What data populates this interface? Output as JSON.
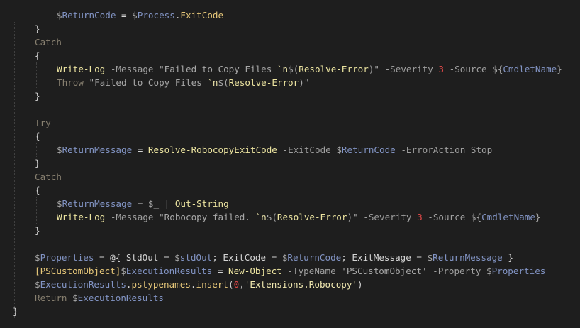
{
  "editor": {
    "colors": {
      "background": "#1e1e1e",
      "keyword": "#888070",
      "variable": "#8294c4",
      "function": "#ece4a0",
      "property": "#e6c779",
      "string": "#a8a8a8",
      "number": "#e04848"
    },
    "lines": [
      {
        "indent": 2,
        "tokens": [
          {
            "t": "$",
            "c": "var"
          },
          {
            "t": "ReturnCode",
            "c": "varname"
          },
          {
            "t": " = ",
            "c": "plain"
          },
          {
            "t": "$",
            "c": "var"
          },
          {
            "t": "Process",
            "c": "varname"
          },
          {
            "t": ".",
            "c": "plain"
          },
          {
            "t": "ExitCode",
            "c": "prop"
          }
        ]
      },
      {
        "indent": 1,
        "tokens": [
          {
            "t": "}",
            "c": "plain"
          }
        ]
      },
      {
        "indent": 1,
        "tokens": [
          {
            "t": "Catch",
            "c": "kw"
          }
        ]
      },
      {
        "indent": 1,
        "tokens": [
          {
            "t": "{",
            "c": "plain"
          }
        ]
      },
      {
        "indent": 2,
        "tokens": [
          {
            "t": "Write-Log",
            "c": "fn"
          },
          {
            "t": " -Message ",
            "c": "param"
          },
          {
            "t": "\"Failed to Copy Files ",
            "c": "str"
          },
          {
            "t": "`n",
            "c": "esc"
          },
          {
            "t": "$(",
            "c": "str"
          },
          {
            "t": "Resolve-Error",
            "c": "fn"
          },
          {
            "t": ")\"",
            "c": "str"
          },
          {
            "t": " -Severity ",
            "c": "param"
          },
          {
            "t": "3",
            "c": "num"
          },
          {
            "t": " -Source ",
            "c": "param"
          },
          {
            "t": "${",
            "c": "var"
          },
          {
            "t": "CmdletName",
            "c": "varname"
          },
          {
            "t": "}",
            "c": "var"
          }
        ]
      },
      {
        "indent": 2,
        "tokens": [
          {
            "t": "Throw",
            "c": "kw"
          },
          {
            "t": " \"Failed to Copy Files ",
            "c": "str"
          },
          {
            "t": "`n",
            "c": "esc"
          },
          {
            "t": "$(",
            "c": "str"
          },
          {
            "t": "Resolve-Error",
            "c": "fn"
          },
          {
            "t": ")\"",
            "c": "str"
          }
        ]
      },
      {
        "indent": 1,
        "tokens": [
          {
            "t": "}",
            "c": "plain"
          }
        ]
      },
      {
        "indent": 0,
        "tokens": []
      },
      {
        "indent": 1,
        "tokens": [
          {
            "t": "Try",
            "c": "kw"
          }
        ]
      },
      {
        "indent": 1,
        "tokens": [
          {
            "t": "{",
            "c": "plain"
          }
        ]
      },
      {
        "indent": 2,
        "tokens": [
          {
            "t": "$",
            "c": "var"
          },
          {
            "t": "ReturnMessage",
            "c": "varname"
          },
          {
            "t": " = ",
            "c": "plain"
          },
          {
            "t": "Resolve-RobocopyExitCode",
            "c": "fn"
          },
          {
            "t": " -ExitCode ",
            "c": "param"
          },
          {
            "t": "$",
            "c": "var"
          },
          {
            "t": "ReturnCode",
            "c": "varname"
          },
          {
            "t": " -ErrorAction Stop",
            "c": "param"
          }
        ]
      },
      {
        "indent": 1,
        "tokens": [
          {
            "t": "}",
            "c": "plain"
          }
        ]
      },
      {
        "indent": 1,
        "tokens": [
          {
            "t": "Catch",
            "c": "kw"
          }
        ]
      },
      {
        "indent": 1,
        "tokens": [
          {
            "t": "{",
            "c": "plain"
          }
        ]
      },
      {
        "indent": 2,
        "tokens": [
          {
            "t": "$",
            "c": "var"
          },
          {
            "t": "ReturnMessage",
            "c": "varname"
          },
          {
            "t": " = ",
            "c": "plain"
          },
          {
            "t": "$_",
            "c": "var"
          },
          {
            "t": " | ",
            "c": "plain"
          },
          {
            "t": "Out-String",
            "c": "fn"
          }
        ]
      },
      {
        "indent": 2,
        "tokens": [
          {
            "t": "Write-Log",
            "c": "fn"
          },
          {
            "t": " -Message ",
            "c": "param"
          },
          {
            "t": "\"Robocopy failed. ",
            "c": "str"
          },
          {
            "t": "`n",
            "c": "esc"
          },
          {
            "t": "$(",
            "c": "str"
          },
          {
            "t": "Resolve-Error",
            "c": "fn"
          },
          {
            "t": ")\"",
            "c": "str"
          },
          {
            "t": " -Severity ",
            "c": "param"
          },
          {
            "t": "3",
            "c": "num"
          },
          {
            "t": " -Source ",
            "c": "param"
          },
          {
            "t": "${",
            "c": "var"
          },
          {
            "t": "CmdletName",
            "c": "varname"
          },
          {
            "t": "}",
            "c": "var"
          }
        ]
      },
      {
        "indent": 1,
        "tokens": [
          {
            "t": "}",
            "c": "plain"
          }
        ]
      },
      {
        "indent": 0,
        "tokens": []
      },
      {
        "indent": 1,
        "tokens": [
          {
            "t": "$",
            "c": "var"
          },
          {
            "t": "Properties",
            "c": "varname"
          },
          {
            "t": " = @{ StdOut = ",
            "c": "plain"
          },
          {
            "t": "$",
            "c": "var"
          },
          {
            "t": "stdOut",
            "c": "varname"
          },
          {
            "t": "; ExitCode = ",
            "c": "plain"
          },
          {
            "t": "$",
            "c": "var"
          },
          {
            "t": "ReturnCode",
            "c": "varname"
          },
          {
            "t": "; ExitMessage = ",
            "c": "plain"
          },
          {
            "t": "$",
            "c": "var"
          },
          {
            "t": "ReturnMessage",
            "c": "varname"
          },
          {
            "t": " }",
            "c": "plain"
          }
        ]
      },
      {
        "indent": 1,
        "tokens": [
          {
            "t": "[PSCustomObject]",
            "c": "type"
          },
          {
            "t": "$",
            "c": "var"
          },
          {
            "t": "ExecutionResults",
            "c": "varname"
          },
          {
            "t": " = ",
            "c": "plain"
          },
          {
            "t": "New-Object",
            "c": "fn"
          },
          {
            "t": " -TypeName ",
            "c": "param"
          },
          {
            "t": "'PSCustomObject'",
            "c": "str"
          },
          {
            "t": " -Property ",
            "c": "param"
          },
          {
            "t": "$",
            "c": "var"
          },
          {
            "t": "Properties",
            "c": "varname"
          }
        ]
      },
      {
        "indent": 1,
        "tokens": [
          {
            "t": "$",
            "c": "var"
          },
          {
            "t": "ExecutionResults",
            "c": "varname"
          },
          {
            "t": ".",
            "c": "plain"
          },
          {
            "t": "pstypenames",
            "c": "prop"
          },
          {
            "t": ".",
            "c": "plain"
          },
          {
            "t": "insert",
            "c": "prop"
          },
          {
            "t": "(",
            "c": "plain"
          },
          {
            "t": "0",
            "c": "num"
          },
          {
            "t": ",",
            "c": "plain"
          },
          {
            "t": "'Extensions.Robocopy'",
            "c": "bold"
          },
          {
            "t": ")",
            "c": "plain"
          }
        ]
      },
      {
        "indent": 1,
        "tokens": [
          {
            "t": "Return ",
            "c": "kw"
          },
          {
            "t": "$",
            "c": "var"
          },
          {
            "t": "ExecutionResults",
            "c": "varname"
          }
        ]
      },
      {
        "indent": 0,
        "tokens": [
          {
            "t": "}",
            "c": "plain"
          }
        ]
      }
    ]
  }
}
